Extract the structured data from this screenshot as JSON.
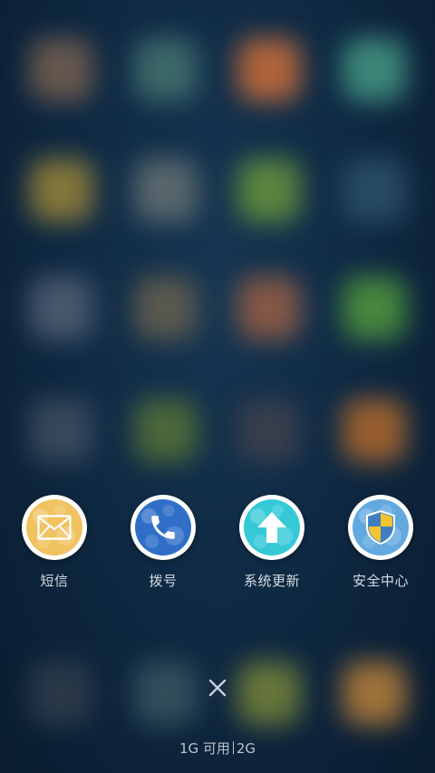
{
  "actions": [
    {
      "label": "短信",
      "icon": "envelope-icon",
      "color": "#f0c260"
    },
    {
      "label": "拨号",
      "icon": "phone-icon",
      "color": "#2f6fc8"
    },
    {
      "label": "系统更新",
      "icon": "upload-arrow-icon",
      "color": "#35c9d8"
    },
    {
      "label": "安全中心",
      "icon": "shield-icon",
      "color": "#62a9e0"
    }
  ],
  "close": {
    "icon": "close-icon"
  },
  "memory": {
    "available": "1G 可用",
    "total": "2G"
  }
}
